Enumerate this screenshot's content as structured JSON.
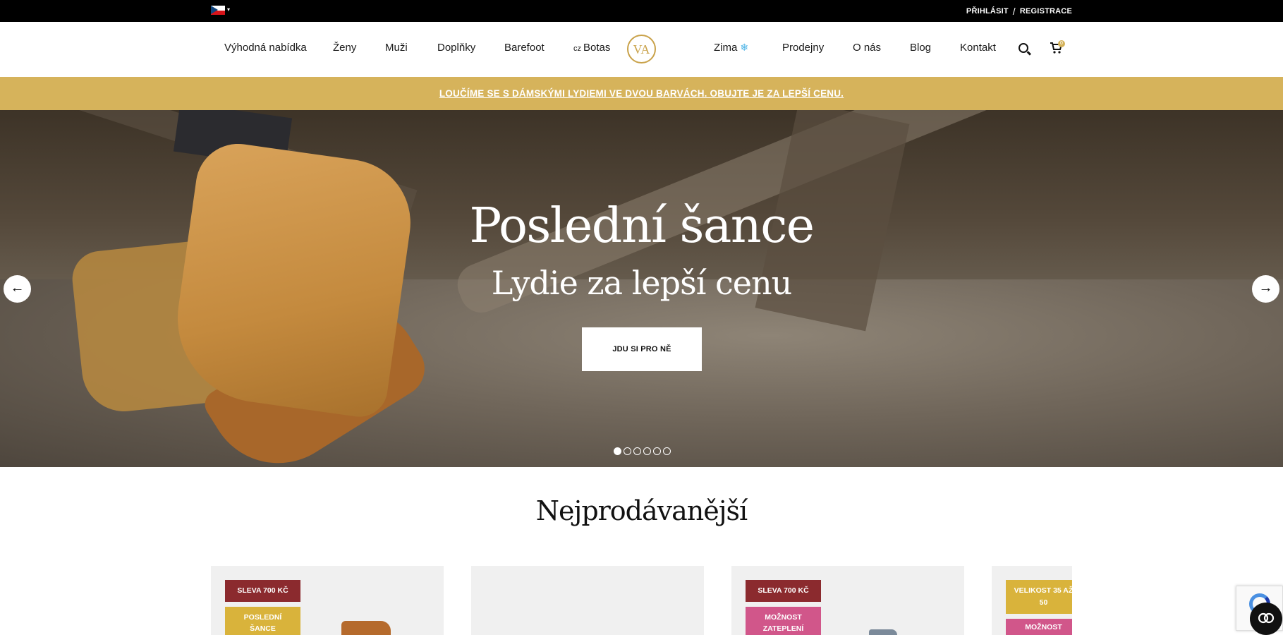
{
  "topbar": {
    "language_icon": "czech-flag-icon",
    "language_caret": "▾",
    "login": "PŘIHLÁSIT",
    "separator": "/",
    "register": "REGISTRACE"
  },
  "nav": {
    "left": [
      "Výhodná nabídka",
      "Ženy",
      "Muži",
      "Doplňky",
      "Barefoot"
    ],
    "botas_prefix": "cz",
    "botas": "Botas",
    "logo_text": "VA",
    "right": [
      "Zima",
      "Prodejny",
      "O nás",
      "Blog",
      "Kontakt"
    ],
    "zima_icon": "❄",
    "cart_count": "0"
  },
  "announcement": "LOUČÍME SE S DÁMSKÝMI LYDIEMI VE DVOU BARVÁCH. OBUJTE JE ZA LEPŠÍ CENU.",
  "hero": {
    "title": "Poslední šance",
    "subtitle": "Lydie za lepší cenu",
    "button": "JDU SI PRO NĚ",
    "prev_arrow": "←",
    "next_arrow": "→",
    "slides_count": 6,
    "active_slide": 1
  },
  "bestsellers": {
    "title": "Nejprodávanější",
    "cards": [
      {
        "badges": [
          {
            "text": "SLEVA 700 KČ",
            "color": "red"
          },
          {
            "text": "POSLEDNÍ ŠANCE",
            "color": "gold"
          }
        ]
      },
      {
        "badges": []
      },
      {
        "badges": [
          {
            "text": "SLEVA 700 KČ",
            "color": "red"
          },
          {
            "text": "MOŽNOST ZATEPLENÍ",
            "color": "pink"
          }
        ]
      },
      {
        "badges": [
          {
            "text": "VELIKOST 35 AŽ 50",
            "color": "gold"
          },
          {
            "text": "MOŽNOST",
            "color": "pink"
          }
        ]
      }
    ]
  },
  "colors": {
    "accent_gold": "#d6b35b",
    "badge_red": "#8b2a2e",
    "badge_pink": "#d1568a"
  }
}
